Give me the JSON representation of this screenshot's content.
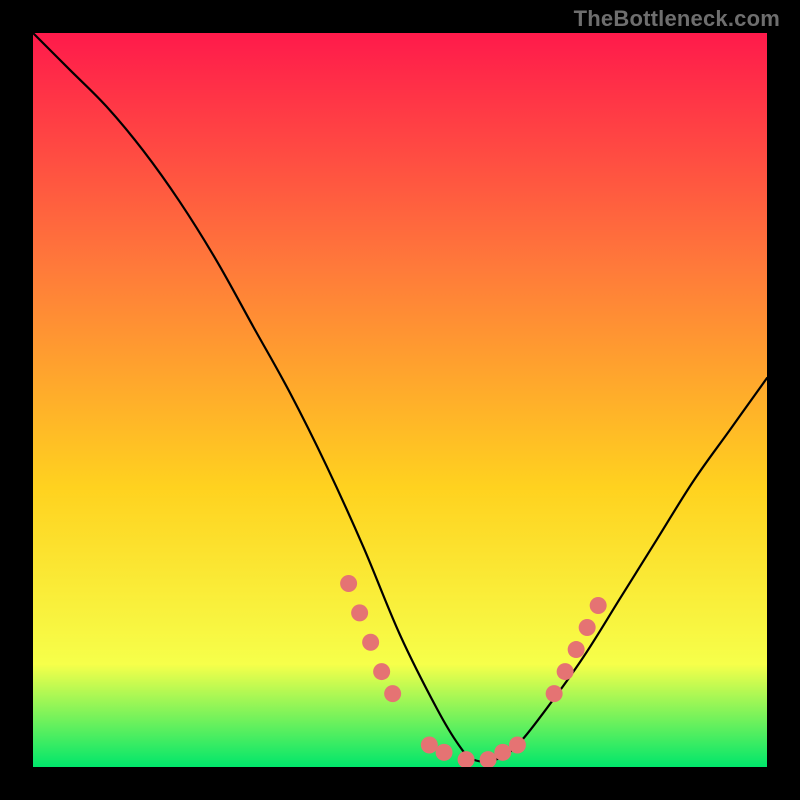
{
  "watermark": "TheBottleneck.com",
  "chart_data": {
    "type": "line",
    "title": "",
    "xlabel": "",
    "ylabel": "",
    "xlim": [
      0,
      100
    ],
    "ylim": [
      0,
      100
    ],
    "background_gradient": {
      "top": "#ff1a4b",
      "mid1": "#ff7a3a",
      "mid2": "#ffd21f",
      "mid3": "#f6ff4a",
      "bottom": "#00e66b"
    },
    "curve": {
      "name": "bottleneck-curve",
      "x": [
        0,
        5,
        10,
        15,
        20,
        25,
        30,
        35,
        40,
        45,
        50,
        55,
        58,
        60,
        63,
        66,
        70,
        75,
        80,
        85,
        90,
        95,
        100
      ],
      "y": [
        100,
        95,
        90,
        84,
        77,
        69,
        60,
        51,
        41,
        30,
        18,
        8,
        3,
        1,
        1,
        3,
        8,
        15,
        23,
        31,
        39,
        46,
        53
      ]
    },
    "highlight_points": {
      "name": "highlight-dots",
      "color": "#e57373",
      "points": [
        {
          "x": 43,
          "y": 25
        },
        {
          "x": 44.5,
          "y": 21
        },
        {
          "x": 46,
          "y": 17
        },
        {
          "x": 47.5,
          "y": 13
        },
        {
          "x": 49,
          "y": 10
        },
        {
          "x": 54,
          "y": 3
        },
        {
          "x": 56,
          "y": 2
        },
        {
          "x": 59,
          "y": 1
        },
        {
          "x": 62,
          "y": 1
        },
        {
          "x": 64,
          "y": 2
        },
        {
          "x": 66,
          "y": 3
        },
        {
          "x": 71,
          "y": 10
        },
        {
          "x": 72.5,
          "y": 13
        },
        {
          "x": 74,
          "y": 16
        },
        {
          "x": 75.5,
          "y": 19
        },
        {
          "x": 77,
          "y": 22
        }
      ]
    }
  }
}
